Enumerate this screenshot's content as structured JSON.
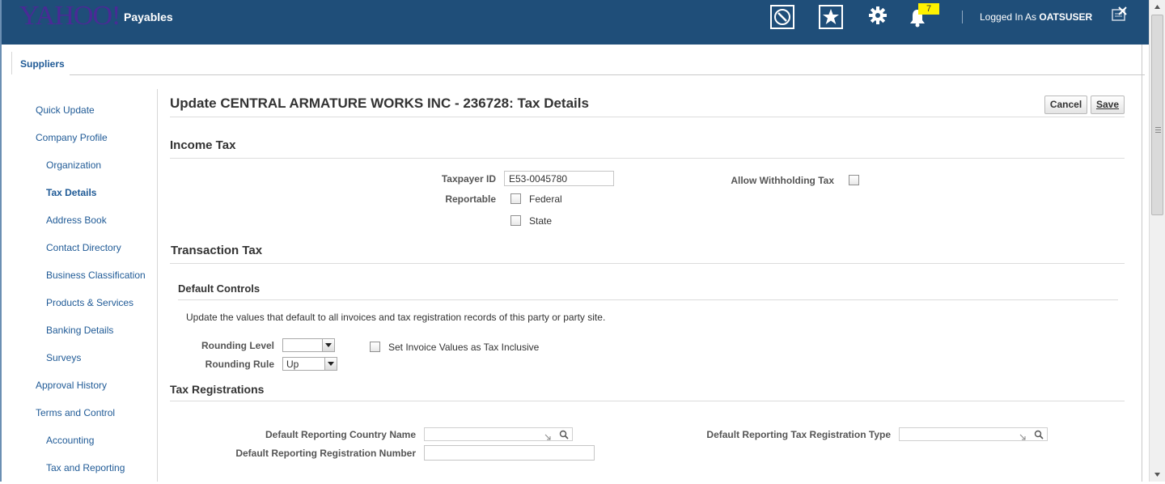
{
  "header": {
    "logo": "YAHOO!",
    "app_title": "Payables",
    "notification_count": "7",
    "logged_in_prefix": "Logged In As",
    "user": "OATSUSER",
    "icons": [
      "navigator-icon",
      "favorites-star-icon",
      "settings-gear-icon",
      "notifications-bell-icon",
      "close-window-icon"
    ]
  },
  "tabs": {
    "suppliers": "Suppliers"
  },
  "sidebar": {
    "items": [
      {
        "label": "Quick Update",
        "level": 1
      },
      {
        "label": "Company Profile",
        "level": 1
      },
      {
        "label": "Organization",
        "level": 2
      },
      {
        "label": "Tax Details",
        "level": 2,
        "active": true
      },
      {
        "label": "Address Book",
        "level": 2
      },
      {
        "label": "Contact Directory",
        "level": 2
      },
      {
        "label": "Business Classification",
        "level": 2
      },
      {
        "label": "Products & Services",
        "level": 2
      },
      {
        "label": "Banking Details",
        "level": 2
      },
      {
        "label": "Surveys",
        "level": 2
      },
      {
        "label": "Approval History",
        "level": 1
      },
      {
        "label": "Terms and Control",
        "level": 1
      },
      {
        "label": "Accounting",
        "level": 2
      },
      {
        "label": "Tax and Reporting",
        "level": 2
      }
    ]
  },
  "main": {
    "title": "Update CENTRAL ARMATURE WORKS INC - 236728: Tax Details",
    "cancel_label": "Cancel",
    "save_label": "Save",
    "income_tax": {
      "heading": "Income Tax",
      "taxpayer_id_label": "Taxpayer ID",
      "taxpayer_id_value": "E53-0045780",
      "reportable_label": "Reportable",
      "federal_label": "Federal",
      "state_label": "State",
      "allow_withholding_label": "Allow Withholding Tax"
    },
    "transaction_tax": {
      "heading": "Transaction Tax",
      "default_controls_heading": "Default Controls",
      "description": "Update the values that default to all invoices and tax registration records of this party or party site.",
      "rounding_level_label": "Rounding Level",
      "rounding_level_value": "",
      "rounding_rule_label": "Rounding Rule",
      "rounding_rule_value": "Up",
      "set_invoice_label": "Set Invoice Values as Tax Inclusive"
    },
    "tax_registrations": {
      "heading": "Tax Registrations",
      "country_label": "Default Reporting Country Name",
      "registration_number_label": "Default Reporting Registration Number",
      "registration_type_label": "Default Reporting Tax Registration Type"
    }
  }
}
